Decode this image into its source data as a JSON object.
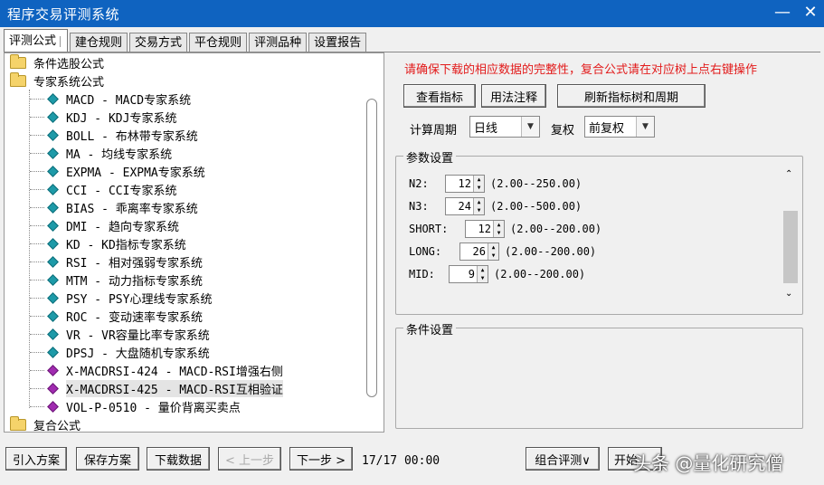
{
  "window": {
    "title": "程序交易评测系统",
    "minimize": "—",
    "close": "✕"
  },
  "tabs": [
    {
      "label": "评测公式",
      "active": true
    },
    {
      "label": "建仓规则"
    },
    {
      "label": "交易方式"
    },
    {
      "label": "平仓规则"
    },
    {
      "label": "评测品种"
    },
    {
      "label": "设置报告"
    }
  ],
  "tree": {
    "folders": {
      "condition": "条件选股公式",
      "expert": "专家系统公式",
      "composite": "复合公式"
    },
    "items": [
      "MACD - MACD专家系统",
      "KDJ - KDJ专家系统",
      "BOLL - 布林带专家系统",
      "MA - 均线专家系统",
      "EXPMA - EXPMA专家系统",
      "CCI - CCI专家系统",
      "BIAS - 乖离率专家系统",
      "DMI - 趋向专家系统",
      "KD - KD指标专家系统",
      "RSI - 相对强弱专家系统",
      "MTM - 动力指标专家系统",
      "PSY - PSY心理线专家系统",
      "ROC - 变动速率专家系统",
      "VR - VR容量比率专家系统",
      "DPSJ - 大盘随机专家系统",
      "X-MACDRSI-424 - MACD-RSI增强右侧",
      "X-MACDRSI-425 - MACD-RSI互相验证",
      "VOL-P-0510 - 量价背离买卖点"
    ]
  },
  "notice": "请确保下载的相应数据的完整性，复合公式请在对应树上点右键操作",
  "buttons": {
    "view_indicator": "查看指标",
    "usage_notes": "用法注释",
    "refresh_tree": "刷新指标树和周期"
  },
  "period": {
    "label": "计算周期",
    "value": "日线"
  },
  "adjust": {
    "label": "复权",
    "value": "前复权"
  },
  "params": {
    "legend": "参数设置",
    "rows": [
      {
        "name": "N2:",
        "value": "12",
        "range": "(2.00--250.00)"
      },
      {
        "name": "N3:",
        "value": "24",
        "range": "(2.00--500.00)"
      },
      {
        "name": "SHORT:",
        "value": "12",
        "range": "(2.00--200.00)"
      },
      {
        "name": "LONG:",
        "value": "26",
        "range": "(2.00--200.00)"
      },
      {
        "name": "MID:",
        "value": "9",
        "range": "(2.00--200.00)"
      }
    ]
  },
  "conditions": {
    "legend": "条件设置"
  },
  "footer": {
    "import": "引入方案",
    "save": "保存方案",
    "download": "下载数据",
    "prev": "< 上一步",
    "next": "下一步 >",
    "progress": "17/17 00:00",
    "combo_eval": "组合评测∨",
    "start": "开始",
    "watermark": "头条 @量化研究僧"
  }
}
